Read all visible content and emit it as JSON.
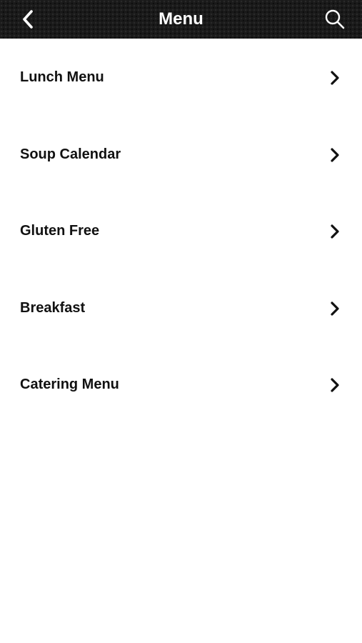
{
  "header": {
    "title": "Menu",
    "back_icon": "chevron-left-icon",
    "search_icon": "search-icon",
    "background_color": "#1a1a1a"
  },
  "menu": {
    "items": [
      {
        "label": "Lunch Menu",
        "icon": "chevron-right-icon"
      },
      {
        "label": "Soup Calendar",
        "icon": "chevron-right-icon"
      },
      {
        "label": "Gluten Free",
        "icon": "chevron-right-icon"
      },
      {
        "label": "Breakfast",
        "icon": "chevron-right-icon"
      },
      {
        "label": "Catering Menu",
        "icon": "chevron-right-icon"
      }
    ]
  }
}
